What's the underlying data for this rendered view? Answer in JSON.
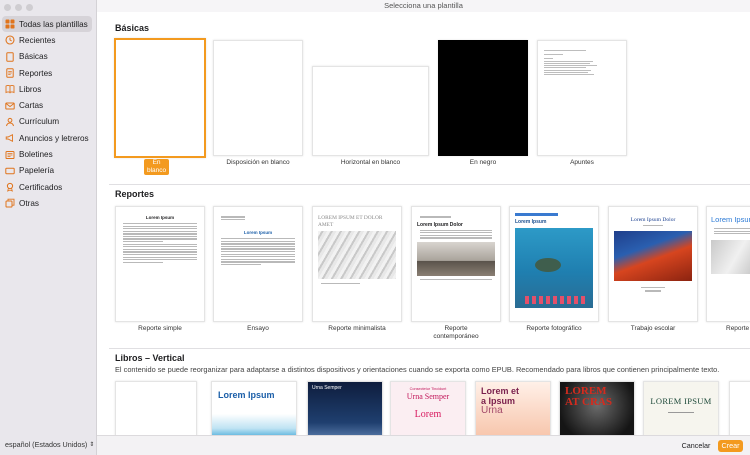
{
  "window": {
    "title": "Selecciona una plantilla"
  },
  "sidebar": {
    "items": [
      {
        "label": "Todas las plantillas",
        "icon": "grid-icon"
      },
      {
        "label": "Recientes",
        "icon": "clock-icon"
      },
      {
        "label": "Básicas",
        "icon": "document-icon"
      },
      {
        "label": "Reportes",
        "icon": "document-icon"
      },
      {
        "label": "Libros",
        "icon": "book-icon"
      },
      {
        "label": "Cartas",
        "icon": "envelope-icon"
      },
      {
        "label": "Currículum",
        "icon": "person-icon"
      },
      {
        "label": "Anuncios y letreros",
        "icon": "megaphone-icon"
      },
      {
        "label": "Boletines",
        "icon": "newspaper-icon"
      },
      {
        "label": "Papelería",
        "icon": "card-icon"
      },
      {
        "label": "Certificados",
        "icon": "certificate-icon"
      },
      {
        "label": "Otras",
        "icon": "stack-icon"
      }
    ],
    "language": "español (Estados Unidos)"
  },
  "sections": {
    "basicas": {
      "title": "Básicas",
      "templates": [
        {
          "label": "En blanco",
          "selected": true
        },
        {
          "label": "Disposición en blanco"
        },
        {
          "label": "Horizontal en blanco"
        },
        {
          "label": "En negro"
        },
        {
          "label": "Apuntes"
        }
      ]
    },
    "reportes": {
      "title": "Reportes",
      "templates": [
        {
          "label": "Reporte simple",
          "heading": "Lorem Ipsum"
        },
        {
          "label": "Ensayo",
          "heading": "Lorem Ipsum"
        },
        {
          "label": "Reporte minimalista",
          "heading": "LOREM IPSUM ET DOLOR AMET"
        },
        {
          "label": "Reporte contemporáneo",
          "heading": "Lorem Ipsum Dolor"
        },
        {
          "label": "Reporte fotográfico",
          "heading": "Lorem Ipsum"
        },
        {
          "label": "Trabajo escolar",
          "heading": "Lorem Ipsum Dolor"
        },
        {
          "label": "Reporte",
          "heading": "Lorem Ipsum"
        }
      ]
    },
    "libros": {
      "title": "Libros – Vertical",
      "description": "El contenido se puede reorganizar para adaptarse a distintos dispositivos y orientaciones cuando se exporta como EPUB. Recomendado para libros que contienen principalmente texto.",
      "covers": [
        {
          "text": ""
        },
        {
          "text": "Lorem Ipsum"
        },
        {
          "text": "Urna Semper"
        },
        {
          "text": "Urna Semper",
          "sub": "Consectetur Tincidunt",
          "extra": "Lorem"
        },
        {
          "text": "Lorem et a Ipsum",
          "extra": "Urna"
        },
        {
          "text": "LOREM AT CRAS"
        },
        {
          "text": "LOREM IPSUM"
        }
      ]
    }
  },
  "footer": {
    "cancel": "Cancelar",
    "create": "Crear"
  },
  "colors": {
    "accent": "#f39a1f",
    "sidebar_bg": "#e9e7ec"
  }
}
